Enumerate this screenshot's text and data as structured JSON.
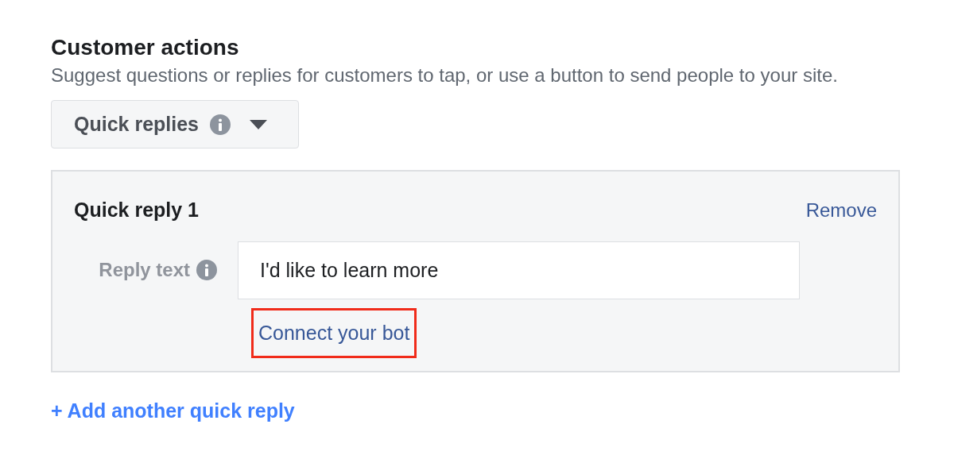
{
  "section": {
    "title": "Customer actions",
    "description": "Suggest questions or replies for customers to tap, or use a button to send people to your site."
  },
  "dropdown": {
    "value": "Quick replies"
  },
  "quick_replies": [
    {
      "title": "Quick reply 1",
      "remove": "Remove",
      "field_label": "Reply text",
      "value": "I'd like to learn more",
      "link": "Connect your bot",
      "highlighted": true
    }
  ],
  "add_link": "+ Add another quick reply"
}
